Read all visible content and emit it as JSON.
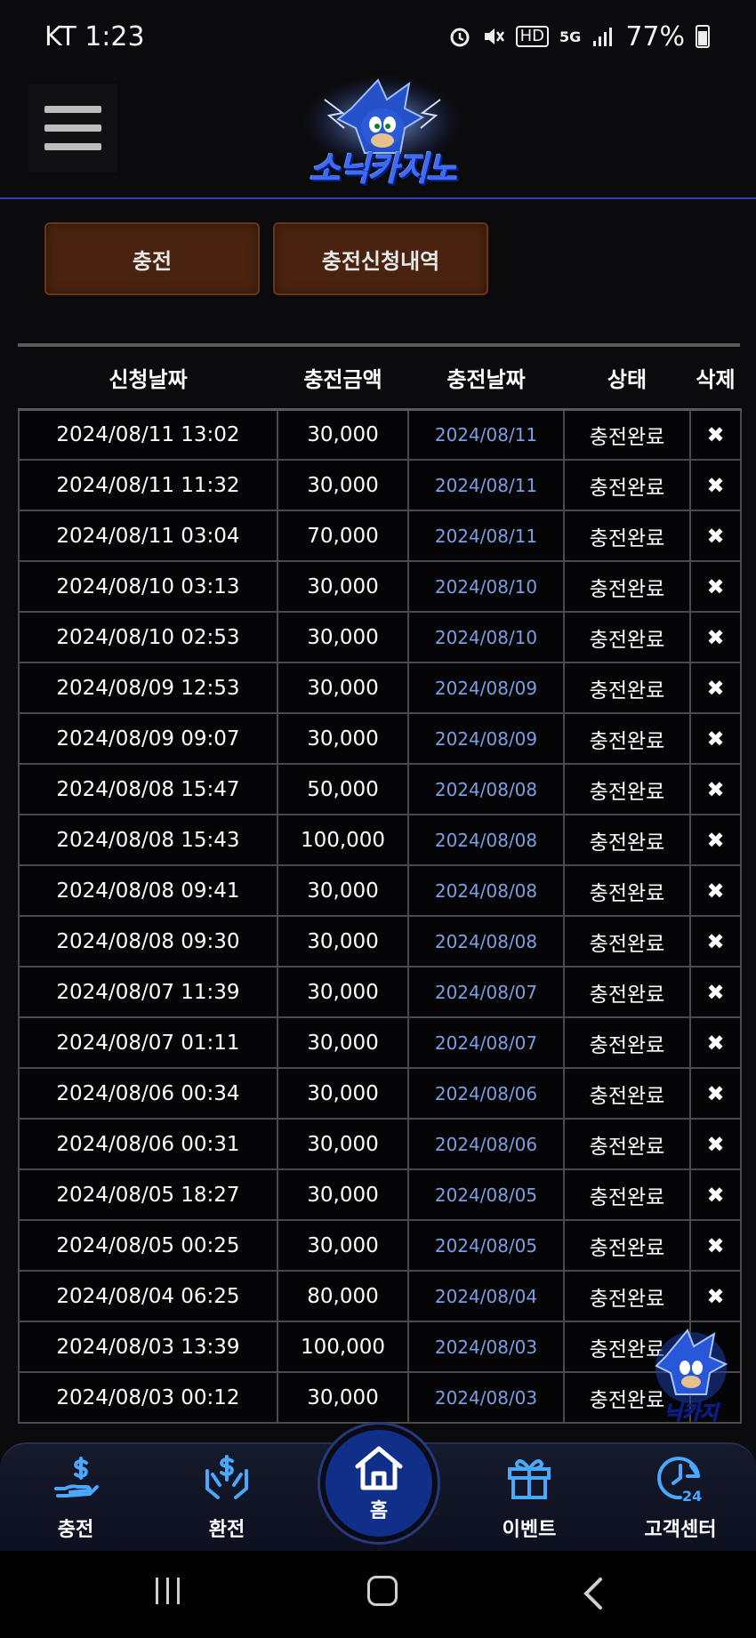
{
  "status_bar": {
    "carrier_time": "KT 1:23",
    "hd_badge": "HD",
    "network": "5G",
    "battery": "77%"
  },
  "header": {
    "logo_text": "소닉카지노",
    "menu_icon": "hamburger-menu-icon"
  },
  "tabs": [
    {
      "label": "충전"
    },
    {
      "label": "충전신청내역"
    }
  ],
  "table": {
    "headers": [
      "신청날짜",
      "충전금액",
      "충전날짜",
      "상태",
      "삭제"
    ],
    "rows": [
      [
        "2024/08/11 13:02",
        "30,000",
        "2024/08/11",
        "충전완료",
        "✖"
      ],
      [
        "2024/08/11 11:32",
        "30,000",
        "2024/08/11",
        "충전완료",
        "✖"
      ],
      [
        "2024/08/11 03:04",
        "70,000",
        "2024/08/11",
        "충전완료",
        "✖"
      ],
      [
        "2024/08/10 03:13",
        "30,000",
        "2024/08/10",
        "충전완료",
        "✖"
      ],
      [
        "2024/08/10 02:53",
        "30,000",
        "2024/08/10",
        "충전완료",
        "✖"
      ],
      [
        "2024/08/09 12:53",
        "30,000",
        "2024/08/09",
        "충전완료",
        "✖"
      ],
      [
        "2024/08/09 09:07",
        "30,000",
        "2024/08/09",
        "충전완료",
        "✖"
      ],
      [
        "2024/08/08 15:47",
        "50,000",
        "2024/08/08",
        "충전완료",
        "✖"
      ],
      [
        "2024/08/08 15:43",
        "100,000",
        "2024/08/08",
        "충전완료",
        "✖"
      ],
      [
        "2024/08/08 09:41",
        "30,000",
        "2024/08/08",
        "충전완료",
        "✖"
      ],
      [
        "2024/08/08 09:30",
        "30,000",
        "2024/08/08",
        "충전완료",
        "✖"
      ],
      [
        "2024/08/07 11:39",
        "30,000",
        "2024/08/07",
        "충전완료",
        "✖"
      ],
      [
        "2024/08/07 01:11",
        "30,000",
        "2024/08/07",
        "충전완료",
        "✖"
      ],
      [
        "2024/08/06 00:34",
        "30,000",
        "2024/08/06",
        "충전완료",
        "✖"
      ],
      [
        "2024/08/06 00:31",
        "30,000",
        "2024/08/06",
        "충전완료",
        "✖"
      ],
      [
        "2024/08/05 18:27",
        "30,000",
        "2024/08/05",
        "충전완료",
        "✖"
      ],
      [
        "2024/08/05 00:25",
        "30,000",
        "2024/08/05",
        "충전완료",
        "✖"
      ],
      [
        "2024/08/04 06:25",
        "80,000",
        "2024/08/04",
        "충전완료",
        "✖"
      ],
      [
        "2024/08/03 13:39",
        "100,000",
        "2024/08/03",
        "충전완료",
        ""
      ],
      [
        "2024/08/03 00:12",
        "30,000",
        "2024/08/03",
        "충전완료",
        ""
      ]
    ]
  },
  "bottom_nav": {
    "charge": "충전",
    "exchange": "환전",
    "home": "홈",
    "event": "이벤트",
    "support": "고객센터"
  },
  "colors": {
    "accent_blue": "#2f3fb4",
    "tab_brown": "#4a2310",
    "date_blue": "#7b9fe0",
    "nav_icon_blue": "#4aa8ff"
  }
}
